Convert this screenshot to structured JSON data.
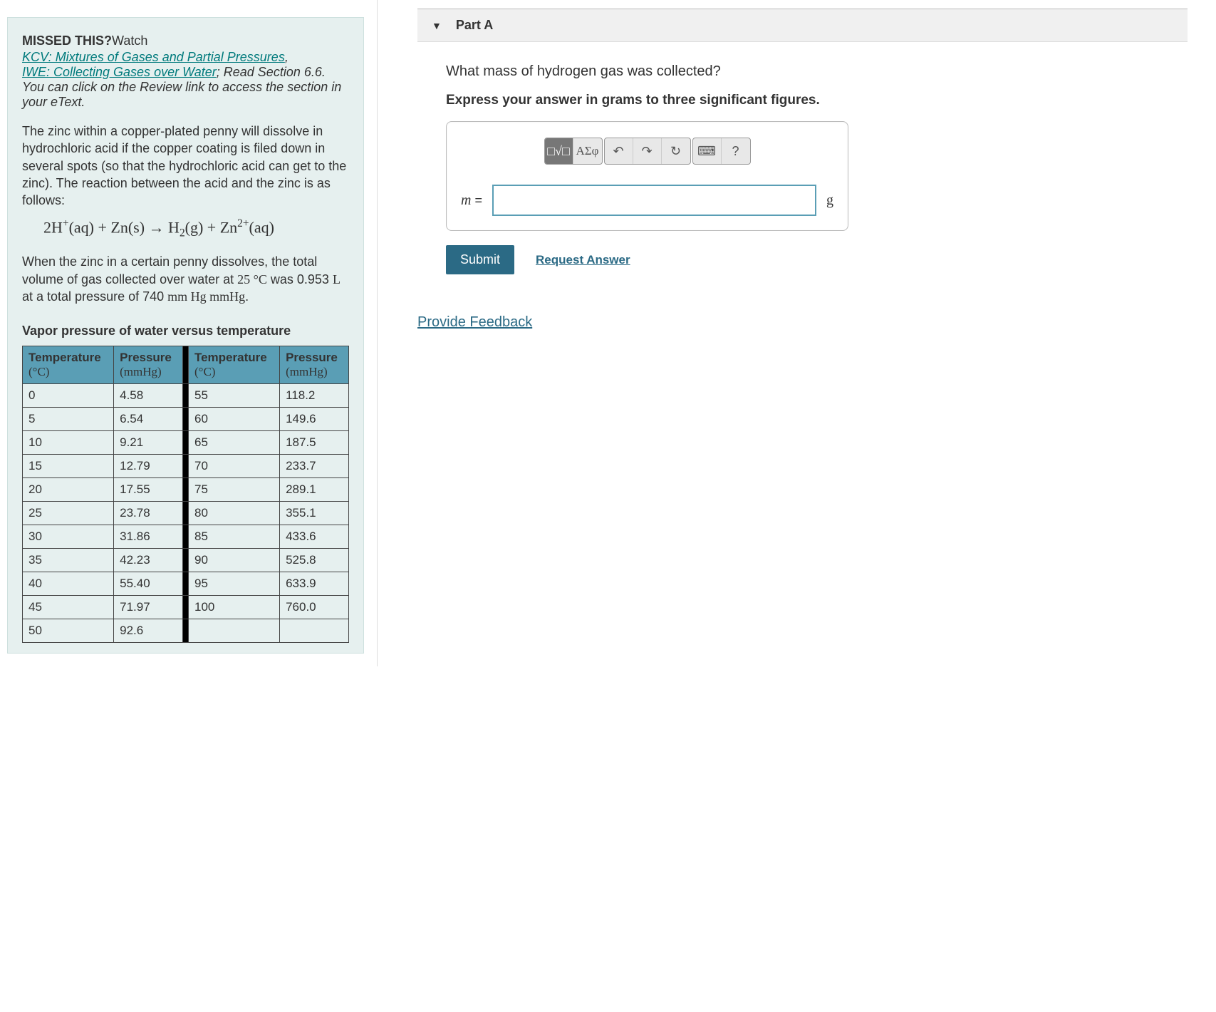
{
  "left": {
    "missed_label": "MISSED THIS?",
    "watch": "Watch",
    "link1": "KCV: Mixtures of Gases and Partial Pressures",
    "link_sep": ",",
    "link2": "IWE: Collecting Gases over Water",
    "read_sec": "; Read Section 6.6.",
    "etext_note": "You can click on the Review link to access the section in your eText.",
    "intro": "The zinc within a copper-plated penny will dissolve in hydrochloric acid if the copper coating is filed down in several spots (so that the hydrochloric acid can get to the zinc). The reaction between the acid and the zinc is as follows:",
    "post_eq_1": "When the zinc in a certain penny dissolves, the total volume of gas collected over water at ",
    "post_eq_temp": "25 °C",
    "post_eq_2": " was 0.953 ",
    "post_eq_unit_L": "L",
    "post_eq_3": " at a total pressure of 740 ",
    "post_eq_mmhg": "mm Hg mmHg",
    "post_eq_4": ".",
    "table_title": "Vapor pressure of water versus temperature",
    "th_temp": "Temperature",
    "th_temp_unit": "(°C)",
    "th_press": "Pressure",
    "th_press_unit": "(mmHg)",
    "rows_left": [
      {
        "t": "0",
        "p": "4.58"
      },
      {
        "t": "5",
        "p": "6.54"
      },
      {
        "t": "10",
        "p": "9.21"
      },
      {
        "t": "15",
        "p": "12.79"
      },
      {
        "t": "20",
        "p": "17.55"
      },
      {
        "t": "25",
        "p": "23.78"
      },
      {
        "t": "30",
        "p": "31.86"
      },
      {
        "t": "35",
        "p": "42.23"
      },
      {
        "t": "40",
        "p": "55.40"
      },
      {
        "t": "45",
        "p": "71.97"
      },
      {
        "t": "50",
        "p": "92.6"
      }
    ],
    "rows_right": [
      {
        "t": "55",
        "p": "118.2"
      },
      {
        "t": "60",
        "p": "149.6"
      },
      {
        "t": "65",
        "p": "187.5"
      },
      {
        "t": "70",
        "p": "233.7"
      },
      {
        "t": "75",
        "p": "289.1"
      },
      {
        "t": "80",
        "p": "355.1"
      },
      {
        "t": "85",
        "p": "433.6"
      },
      {
        "t": "90",
        "p": "525.8"
      },
      {
        "t": "95",
        "p": "633.9"
      },
      {
        "t": "100",
        "p": "760.0"
      },
      {
        "t": "",
        "p": ""
      }
    ]
  },
  "right": {
    "part_label": "Part A",
    "question": "What mass of hydrogen gas was collected?",
    "instruction": "Express your answer in grams to three significant figures.",
    "var_label": "m",
    "equals": " =",
    "unit": "g",
    "toolbar": {
      "templates_hint": "□√□",
      "greek": "ΑΣφ",
      "undo": "↶",
      "redo": "↷",
      "reset": "↻",
      "keyboard": "⌨",
      "help": "?"
    },
    "submit": "Submit",
    "request_answer": "Request Answer",
    "feedback": "Provide Feedback"
  }
}
